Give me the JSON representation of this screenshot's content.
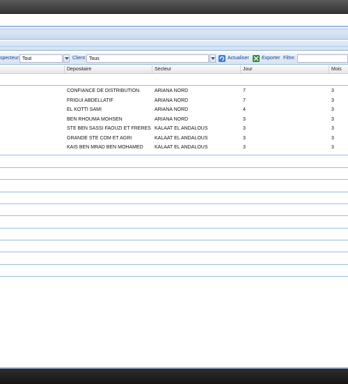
{
  "toolbar": {
    "inspecteur_label": "specteur:",
    "inspecteur_value": "Tout",
    "client_label": "Client:",
    "client_value": "Tous",
    "refresh_label": "Actualiser",
    "export_label": "Exporter",
    "filter_label": "Filtre:",
    "filter_value": ""
  },
  "grid": {
    "columns": [
      "Depositaire",
      "Secteur",
      "Jour",
      "Mois"
    ],
    "rows": [
      {
        "depositaire": "CONFIANCE DE DISTRIBUTION",
        "secteur": "ARIANA NORD",
        "jour": "7",
        "mois": "3"
      },
      {
        "depositaire": "FRIGUI ABDELLATIF",
        "secteur": "ARIANA NORD",
        "jour": "7",
        "mois": "3"
      },
      {
        "depositaire": "EL KOTTI SAMI",
        "secteur": "ARIANA NORD",
        "jour": "4",
        "mois": "3"
      },
      {
        "depositaire": "BEN RHOUMA MOHSEN",
        "secteur": "ARIANA NORD",
        "jour": "3",
        "mois": "3"
      },
      {
        "depositaire": "STE BEN SASSI FAOUZI ET FRERES",
        "secteur": "KALAAT EL ANDALOUS",
        "jour": "3",
        "mois": "3"
      },
      {
        "depositaire": "GRANDE STE COM ET AGRI",
        "secteur": "KALAAT EL ANDALOUS",
        "jour": "3",
        "mois": "3"
      },
      {
        "depositaire": "KAIS BEN MRAD BEN MOHAMED",
        "secteur": "KALAAT EL ANDALOUS",
        "jour": "3",
        "mois": "3"
      }
    ]
  },
  "icons": {
    "refresh": "refresh-icon",
    "export": "excel-export-icon",
    "dropdown": "chevron-down-icon"
  },
  "colors": {
    "accent": "#99bbe8",
    "toolbar_text": "#15428b",
    "export_green": "#2e8b3a",
    "refresh_blue": "#3a7bd5"
  }
}
